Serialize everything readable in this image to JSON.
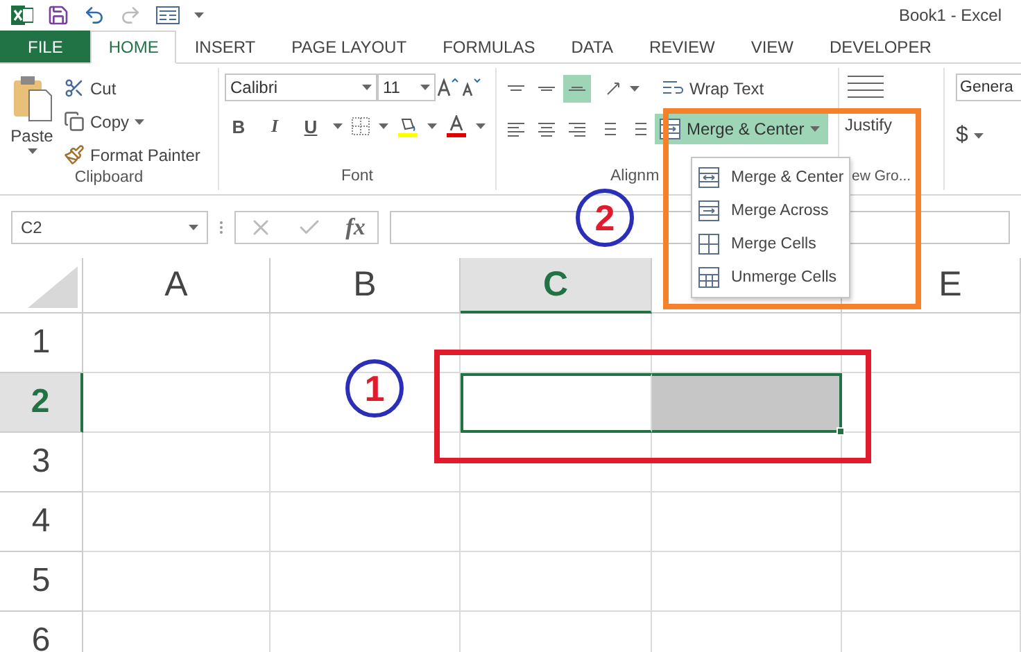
{
  "window": {
    "title": "Book1 - Excel"
  },
  "tabs": [
    {
      "label": "FILE",
      "kind": "file",
      "selected": false
    },
    {
      "label": "HOME",
      "kind": "tab",
      "selected": true
    },
    {
      "label": "INSERT",
      "kind": "tab",
      "selected": false
    },
    {
      "label": "PAGE LAYOUT",
      "kind": "tab",
      "selected": false
    },
    {
      "label": "FORMULAS",
      "kind": "tab",
      "selected": false
    },
    {
      "label": "DATA",
      "kind": "tab",
      "selected": false
    },
    {
      "label": "REVIEW",
      "kind": "tab",
      "selected": false
    },
    {
      "label": "VIEW",
      "kind": "tab",
      "selected": false
    },
    {
      "label": "DEVELOPER",
      "kind": "tab",
      "selected": false
    }
  ],
  "clipboard": {
    "paste": "Paste",
    "cut": "Cut",
    "copy": "Copy",
    "format_painter": "Format Painter",
    "label": "Clipboard"
  },
  "font": {
    "name": "Calibri",
    "size": "11",
    "bold": "B",
    "italic": "I",
    "underline": "U",
    "label": "Font"
  },
  "alignment": {
    "wrap_text": "Wrap Text",
    "merge": "Merge & Center",
    "merge_open": true,
    "bottom_align_selected": true,
    "label": "Alignm"
  },
  "new_group": {
    "justify": "Justify",
    "label": "ew Gro..."
  },
  "number": {
    "format": "Genera",
    "currency": "$"
  },
  "merge_menu": [
    {
      "label": "Merge & Center",
      "kind": "center"
    },
    {
      "label": "Merge Across",
      "kind": "across"
    },
    {
      "label": "Merge Cells",
      "kind": "cells"
    },
    {
      "label": "Unmerge Cells",
      "kind": "unmerge"
    }
  ],
  "formula_bar": {
    "name_box": "C2",
    "fx": "fx"
  },
  "columns": [
    {
      "label": "A",
      "selected": false
    },
    {
      "label": "B",
      "selected": false
    },
    {
      "label": "C",
      "selected": true
    },
    {
      "selected": false
    },
    {
      "label": "E",
      "selected": false
    }
  ],
  "rows": [
    {
      "label": "1",
      "selected": false,
      "cells": [
        {
          "selected": false,
          "active": false
        },
        {
          "selected": false,
          "active": false
        },
        {
          "selected": false,
          "active": false
        },
        {
          "selected": false,
          "active": false
        },
        {
          "selected": false,
          "active": false
        }
      ]
    },
    {
      "label": "2",
      "selected": true,
      "cells": [
        {
          "selected": false,
          "active": false
        },
        {
          "selected": false,
          "active": false
        },
        {
          "selected": true,
          "active": true
        },
        {
          "selected": true,
          "active": false
        },
        {
          "selected": false,
          "active": false
        }
      ]
    },
    {
      "label": "3",
      "selected": false,
      "cells": [
        {
          "selected": false,
          "active": false
        },
        {
          "selected": false,
          "active": false
        },
        {
          "selected": false,
          "active": false
        },
        {
          "selected": false,
          "active": false
        },
        {
          "selected": false,
          "active": false
        }
      ]
    },
    {
      "label": "4",
      "selected": false,
      "cells": [
        {
          "selected": false,
          "active": false
        },
        {
          "selected": false,
          "active": false
        },
        {
          "selected": false,
          "active": false
        },
        {
          "selected": false,
          "active": false
        },
        {
          "selected": false,
          "active": false
        }
      ]
    },
    {
      "label": "5",
      "selected": false,
      "cells": [
        {
          "selected": false,
          "active": false
        },
        {
          "selected": false,
          "active": false
        },
        {
          "selected": false,
          "active": false
        },
        {
          "selected": false,
          "active": false
        },
        {
          "selected": false,
          "active": false
        }
      ]
    },
    {
      "label": "6",
      "selected": false,
      "cells": [
        {
          "selected": false,
          "active": false
        },
        {
          "selected": false,
          "active": false
        },
        {
          "selected": false,
          "active": false
        },
        {
          "selected": false,
          "active": false
        },
        {
          "selected": false,
          "active": false
        }
      ]
    }
  ],
  "annotations": [
    {
      "label": "1",
      "kind": "cells"
    },
    {
      "label": "2",
      "kind": "menu"
    }
  ]
}
